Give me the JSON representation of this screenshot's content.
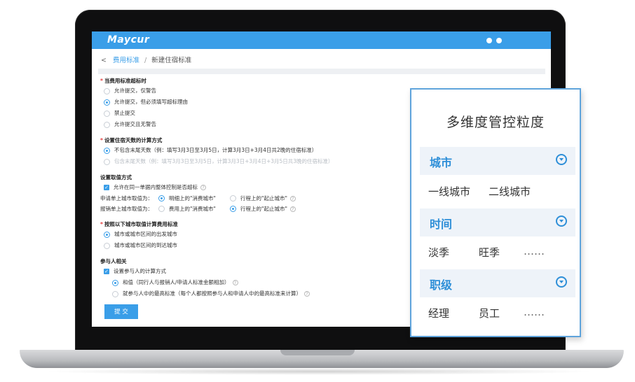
{
  "app": {
    "logo": "Maycur"
  },
  "breadcrumb": {
    "back": "<",
    "parent": "费用标准",
    "separator": "/",
    "current": "新建住宿标准"
  },
  "form": {
    "over_limit": {
      "title": "当费用标准超标时",
      "options": [
        "允许提交，仅警告",
        "允许提交，但必须填写超标理由",
        "禁止提交",
        "允许提交且无警告"
      ],
      "selected": 1
    },
    "days_calc": {
      "title": "设置住宿天数的计算方式",
      "options": [
        "不包含末尾天数（例：填写3月3日至3月5日，计算3月3日+3月4日共2晚的住宿标准）",
        "包含末尾天数（例：填写3月3日至3月5日，计算3月3日+3月4日+3月5日共3晚的住宿标准）"
      ],
      "selected": 0
    },
    "city_value": {
      "title": "设置取值方式",
      "checkbox_label": "允许在同一单据内整体控制是否超标",
      "apply_label": "申请单上城市取值为：",
      "apply_opt1": "明细上的\"消费城市\"",
      "apply_opt2": "行程上的\"起止城市\"",
      "reimb_label": "报销单上城市取值为：",
      "reimb_opt1": "费用上的\"消费城市\"",
      "reimb_opt2": "行程上的\"起止城市\""
    },
    "city_calc": {
      "title": "按照以下城市取值计算费用标准",
      "options": [
        "城市或城市区间的出发城市",
        "城市或城市区间的到达城市"
      ],
      "selected": 0
    },
    "participants": {
      "title": "参与人相关",
      "checkbox_label": "设置参与人的计算方式",
      "options": [
        "和值（同行人与报销人/申请人标准金额相加）",
        "就参与人中的最高标准（每个人都按照参与人和申请人中的最高标准来计算）"
      ],
      "selected": 0
    },
    "submit_label": "提 交"
  },
  "panel": {
    "title": "多维度管控粒度",
    "categories": [
      {
        "label": "城市",
        "values": [
          "一线城市",
          "二线城市"
        ]
      },
      {
        "label": "时间",
        "values": [
          "淡季",
          "旺季",
          "……"
        ]
      },
      {
        "label": "职级",
        "values": [
          "经理",
          "员工",
          "……"
        ]
      }
    ]
  },
  "colors": {
    "brand": "#3a9ee8",
    "panel_border": "#5fa4dc",
    "required": "#e54040"
  }
}
